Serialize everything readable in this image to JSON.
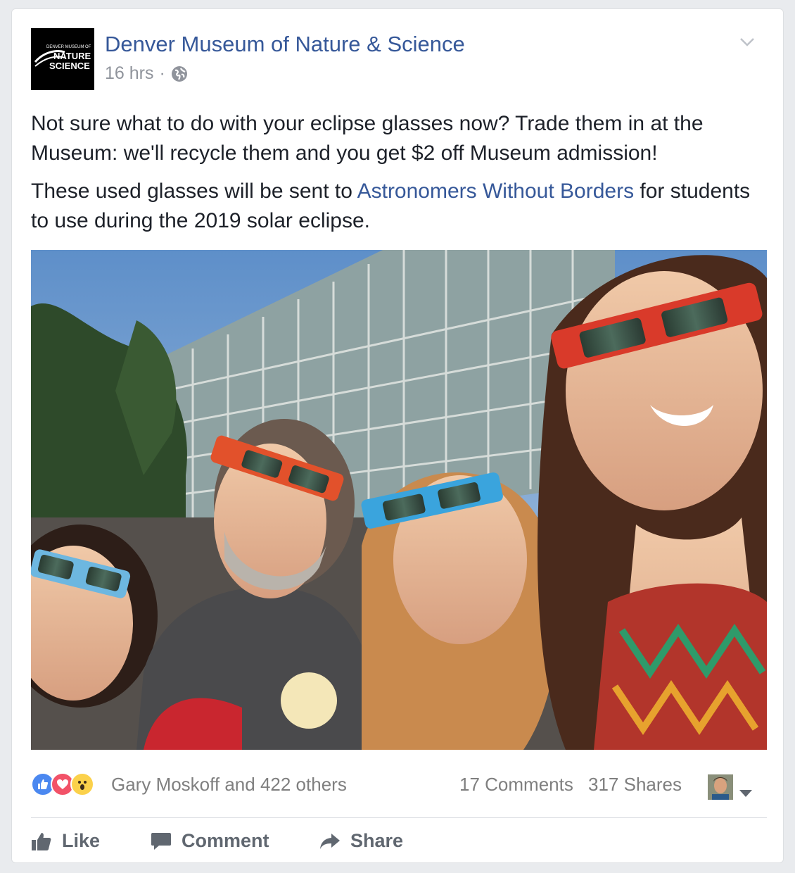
{
  "post": {
    "page_name": "Denver Museum of Nature & Science",
    "time": "16 hrs",
    "separator": "·",
    "avatar_text": {
      "line1": "DENVER MUSEUM OF",
      "line2": "NATURE &",
      "line3": "SCIENCE"
    },
    "paragraph1": "Not sure what to do with your eclipse glasses now? Trade them in at the Museum: we'll recycle them and you get $2 off Museum admission!",
    "paragraph2_before": "These used glasses will be sent to ",
    "paragraph2_link": "Astronomers Without Borders",
    "paragraph2_after": " for students to use during the 2019 solar eclipse."
  },
  "stats": {
    "reactions": [
      "like",
      "love",
      "wow"
    ],
    "reactors": "Gary Moskoff and 422 others",
    "comments": "17 Comments",
    "shares": "317 Shares"
  },
  "actions": {
    "like": "Like",
    "comment": "Comment",
    "share": "Share"
  },
  "colors": {
    "link": "#365899",
    "meta": "#90949c",
    "like_blue": "#4b88f0",
    "love_red": "#f25268",
    "wow_yellow": "#fbd14b"
  }
}
